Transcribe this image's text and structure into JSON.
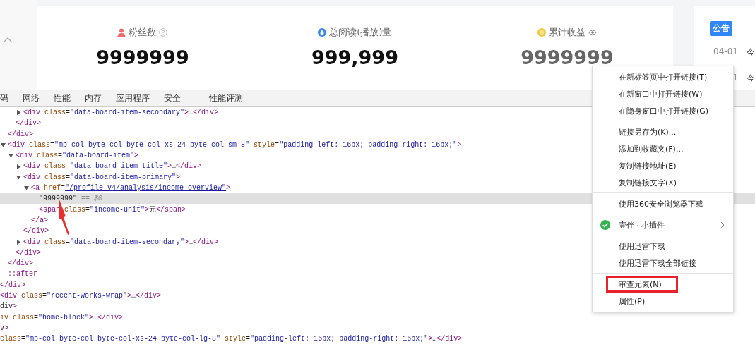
{
  "stats": [
    {
      "label": "粉丝数",
      "value": "9999999",
      "dimmed": false
    },
    {
      "label": "总阅读(播放)量",
      "value": "999,999",
      "dimmed": false
    },
    {
      "label": "累计收益",
      "value": "9999999",
      "dimmed": true
    }
  ],
  "notice": {
    "badge": "公告",
    "items": [
      {
        "date": "04-01",
        "text": "今"
      },
      {
        "date": "1",
        "text": "今"
      }
    ]
  },
  "devtools": {
    "tabs": [
      {
        "label": "码"
      },
      {
        "label": "网络"
      },
      {
        "label": "性能"
      },
      {
        "label": "内存"
      },
      {
        "label": "应用程序"
      },
      {
        "label": "安全"
      },
      {
        "label": "性能评测"
      }
    ],
    "dom": [
      {
        "kind": "fragment",
        "close": "</div>",
        "children": [
          {
            "kind": "fragment",
            "close": "</div>",
            "children": [
              {
                "kind": "fragment",
                "close": "</div>",
                "children": [
                  {
                    "kind": "tag",
                    "text": "<div class=\"data-board-item-secondary\">…</div>",
                    "expanded": false,
                    "selected": false
                  }
                ]
              }
            ]
          },
          {
            "kind": "tag",
            "text": "<div class=\"mp-col byte-col byte-col-xs-24 byte-col-sm-8\" style=\"padding-left: 16px; padding-right: 16px;\">",
            "expanded": true,
            "selected": false,
            "close": "</div>",
            "children": [
              {
                "kind": "tag",
                "text": "<div class=\"data-board-item\">",
                "expanded": true,
                "selected": false,
                "close": "</div>",
                "children": [
                  {
                    "kind": "tag",
                    "text": "<div class=\"data-board-item-title\">…</div>",
                    "expanded": false,
                    "selected": false
                  },
                  {
                    "kind": "tag",
                    "text": "<div class=\"data-board-item-primary\">",
                    "expanded": true,
                    "selected": false,
                    "close": "</div>",
                    "children": [
                      {
                        "kind": "tag",
                        "text": "<a href=\"/profile_v4/analysis/income-overview\">",
                        "expanded": true,
                        "selected": false,
                        "close": "</a>",
                        "children": [
                          {
                            "kind": "text",
                            "text": "\"9999999\"",
                            "ref": "== $0",
                            "selected": true
                          },
                          {
                            "kind": "tag",
                            "text": "<span class=\"income-unit\">元</span>",
                            "selected": false
                          }
                        ]
                      }
                    ]
                  },
                  {
                    "kind": "tag",
                    "text": "<div class=\"data-board-item-secondary\">…</div>",
                    "expanded": false,
                    "selected": false
                  }
                ]
              }
            ]
          },
          {
            "kind": "pseudo",
            "text": "::after",
            "selected": false
          }
        ]
      },
      {
        "kind": "tag",
        "text": "<div class=\"recent-works-wrap\">…</div>",
        "selected": false
      },
      {
        "kind": "tag",
        "text": "div>",
        "selected": false
      },
      {
        "kind": "tag",
        "text": "iv class=\"home-block\">…</div>",
        "selected": false
      },
      {
        "kind": "tag",
        "text": "v>",
        "selected": false
      },
      {
        "kind": "tag",
        "text": "class=\"mp-col byte-col byte-col-xs-24 byte-col-lg-8\" style=\"padding-left: 16px; padding-right: 16px;\">…</div>",
        "selected": false
      }
    ]
  },
  "menu": {
    "sections": [
      {
        "items": [
          {
            "kind": "plain",
            "label": "在新标签页中打开链接(T)",
            "marked": false
          },
          {
            "kind": "plain",
            "label": "在新窗口中打开链接(W)",
            "marked": false
          },
          {
            "kind": "plain",
            "label": "在隐身窗口中打开链接(G)",
            "marked": false
          }
        ]
      },
      {
        "items": [
          {
            "kind": "plain",
            "label": "链接另存为(K)...",
            "marked": false
          },
          {
            "kind": "plain",
            "label": "添加到收藏夹(F)...",
            "marked": false
          },
          {
            "kind": "plain",
            "label": "复制链接地址(E)",
            "marked": false
          },
          {
            "kind": "plain",
            "label": "复制链接文字(X)",
            "marked": false
          }
        ]
      },
      {
        "items": [
          {
            "kind": "plain",
            "label": "使用360安全浏览器下载",
            "marked": false
          }
        ]
      },
      {
        "items": [
          {
            "kind": "extension",
            "label": "壹伴 · 小插件",
            "marked": false
          }
        ]
      },
      {
        "items": [
          {
            "kind": "plain",
            "label": "使用迅雷下载",
            "marked": false
          },
          {
            "kind": "plain",
            "label": "使用迅雷下载全部链接",
            "marked": false
          }
        ]
      },
      {
        "items": [
          {
            "kind": "plain",
            "label": "审查元素(N)",
            "marked": true
          },
          {
            "kind": "plain",
            "label": "属性(P)",
            "marked": false
          }
        ]
      }
    ]
  }
}
